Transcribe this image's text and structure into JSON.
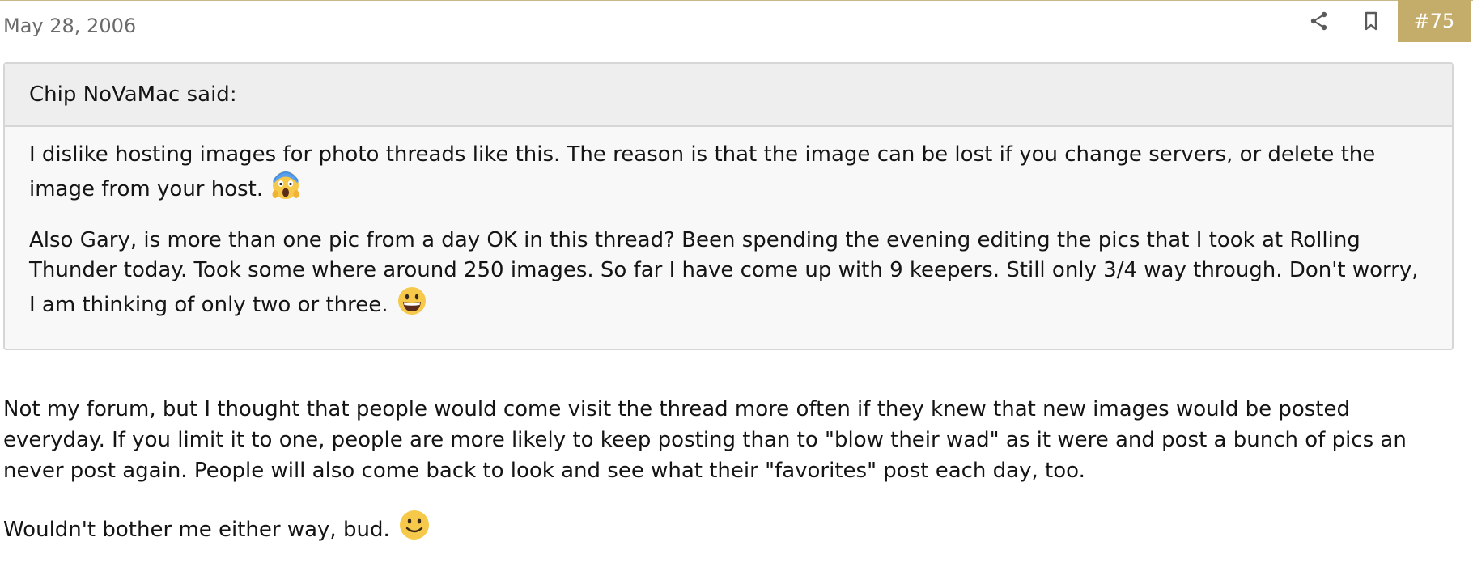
{
  "post": {
    "date": "May 28, 2006",
    "number": "#75",
    "accent_color": "#c4ad6b",
    "actions": [
      {
        "icon": "share-icon"
      },
      {
        "icon": "bookmark-icon"
      }
    ]
  },
  "quote": {
    "attribution": "Chip NoVaMac said:",
    "paragraph1": "I dislike hosting images for photo threads like this. The reason is that the image can be lost if you change servers, or delete the image from your host.",
    "paragraph1_emoji": "screaming-face-emoji",
    "paragraph2": "Also Gary, is more than one pic from a day OK in this thread? Been spending the evening editing the pics that I took at Rolling Thunder today. Took some where around 250 images. So far I have come up with 9 keepers. Still only 3/4 way through. Don't worry, I am thinking of only two or three.",
    "paragraph2_emoji": "grinning-face-emoji"
  },
  "message": {
    "paragraph1": "Not my forum, but I thought that people would come visit the thread more often if they knew that new images would be posted everyday. If you limit it to one, people are more likely to keep posting than to \"blow their wad\" as it were and post a bunch of pics an never post again. People will also come back to look and see what their \"favorites\" post each day, too.",
    "paragraph2": "Wouldn't bother me either way, bud.",
    "paragraph2_emoji": "smiling-face-emoji"
  }
}
